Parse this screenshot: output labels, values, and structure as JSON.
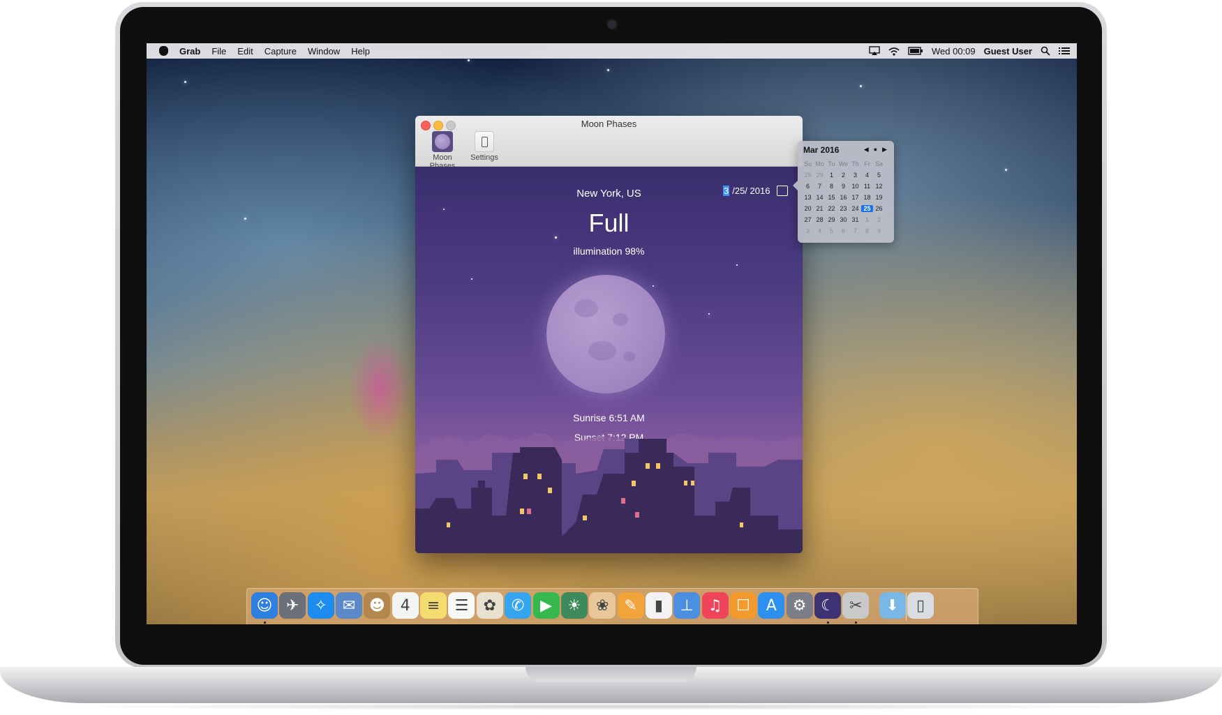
{
  "menubar": {
    "app_name": "Grab",
    "menus": [
      "File",
      "Edit",
      "Capture",
      "Window",
      "Help"
    ],
    "clock": "Wed 00:09",
    "user": "Guest User"
  },
  "window": {
    "title": "Moon Phases",
    "toolbar": {
      "moon_phases_label": "Moon Phases",
      "settings_label": "Settings"
    },
    "location": "New York, US",
    "phase": "Full",
    "illumination": "illumination 98%",
    "illumination_value": 0.98,
    "date_selected_part": "3",
    "date_rest": "/25/ 2016",
    "sunrise": "Sunrise 6:51 AM",
    "sunset": "Sunset 7:12 PM"
  },
  "calendar_popover": {
    "month_label": "Mar 2016",
    "weekdays": [
      "Su",
      "Mo",
      "Tu",
      "We",
      "Th",
      "Fr",
      "Sa"
    ],
    "weeks": [
      [
        "28",
        "29",
        "1",
        "2",
        "3",
        "4",
        "5"
      ],
      [
        "6",
        "7",
        "8",
        "9",
        "10",
        "11",
        "12"
      ],
      [
        "13",
        "14",
        "15",
        "16",
        "17",
        "18",
        "19"
      ],
      [
        "20",
        "21",
        "22",
        "23",
        "24",
        "25",
        "26"
      ],
      [
        "27",
        "28",
        "29",
        "30",
        "31",
        "1",
        "2"
      ],
      [
        "3",
        "4",
        "5",
        "6",
        "7",
        "8",
        "9"
      ]
    ],
    "selected_day": "25"
  },
  "dock": {
    "apps": [
      {
        "icon": "finder-icon",
        "glyph": "☺",
        "color": "#2f7fe0",
        "running": true
      },
      {
        "icon": "launchpad-icon",
        "glyph": "✈",
        "color": "#6b6f78",
        "running": false
      },
      {
        "icon": "safari-icon",
        "glyph": "✧",
        "color": "#1d8cf0",
        "running": false
      },
      {
        "icon": "mail-icon",
        "glyph": "✉",
        "color": "#5a88c8",
        "running": false
      },
      {
        "icon": "contacts-icon",
        "glyph": "☻",
        "color": "#b4874e",
        "running": false
      },
      {
        "icon": "calendar-icon",
        "glyph": "4",
        "color": "#f4f4f4",
        "running": false
      },
      {
        "icon": "notes-icon",
        "glyph": "≡",
        "color": "#f5dc6e",
        "running": false
      },
      {
        "icon": "reminders-icon",
        "glyph": "☰",
        "color": "#f8f8f8",
        "running": false
      },
      {
        "icon": "photos-icon",
        "glyph": "✿",
        "color": "#e8e1d0",
        "running": false
      },
      {
        "icon": "messages-icon",
        "glyph": "✆",
        "color": "#35a5f0",
        "running": false
      },
      {
        "icon": "facetime-icon",
        "glyph": "▶",
        "color": "#36b84d",
        "running": false
      },
      {
        "icon": "photo-booth-icon",
        "glyph": "☀",
        "color": "#3f8a5a",
        "running": false
      },
      {
        "icon": "iphoto-icon",
        "glyph": "❀",
        "color": "#e9c79a",
        "running": false
      },
      {
        "icon": "pages-icon",
        "glyph": "✎",
        "color": "#f2a43a",
        "running": false
      },
      {
        "icon": "numbers-icon",
        "glyph": "▮",
        "color": "#f3f3f3",
        "running": false
      },
      {
        "icon": "keynote-icon",
        "glyph": "⊥",
        "color": "#4a8fe0",
        "running": false
      },
      {
        "icon": "itunes-icon",
        "glyph": "♫",
        "color": "#f0445a",
        "running": false
      },
      {
        "icon": "ibooks-icon",
        "glyph": "☐",
        "color": "#f29a2e",
        "running": false
      },
      {
        "icon": "app-store-icon",
        "glyph": "A",
        "color": "#2d8ff0",
        "running": false
      },
      {
        "icon": "system-preferences-icon",
        "glyph": "⚙",
        "color": "#7b7e86",
        "running": false
      },
      {
        "icon": "moon-phases-icon",
        "glyph": "☾",
        "color": "#3e3174",
        "running": true
      },
      {
        "icon": "grab-icon",
        "glyph": "✂",
        "color": "#c9c9c9",
        "running": true
      },
      {
        "icon": "downloads-icon",
        "glyph": "⬇",
        "color": "#78b7e6",
        "running": false
      },
      {
        "icon": "trash-icon",
        "glyph": "▯",
        "color": "#d9dde2",
        "running": false
      }
    ]
  }
}
